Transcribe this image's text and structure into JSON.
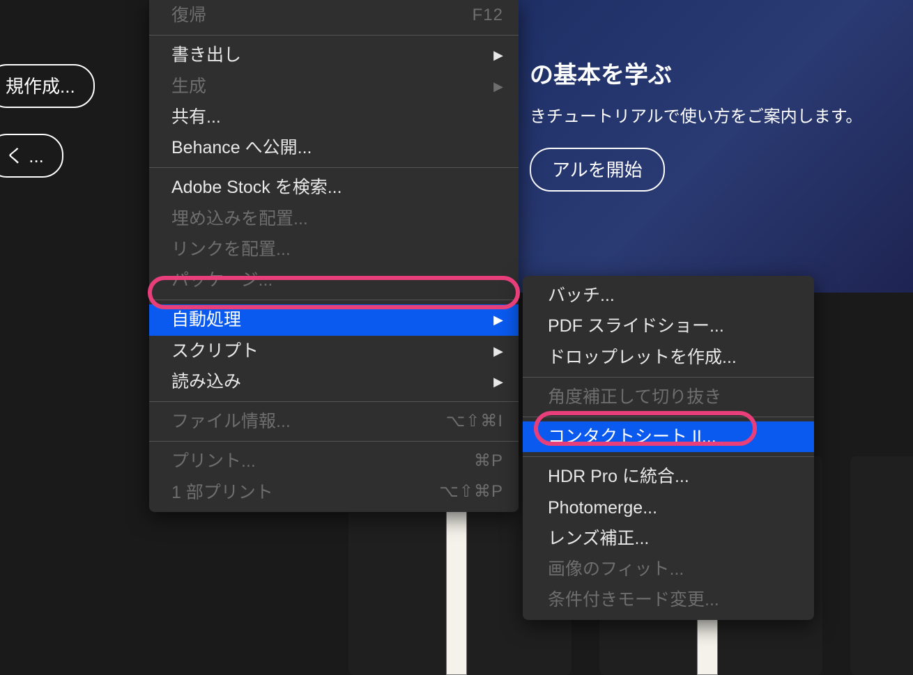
{
  "welcome": {
    "title": "の基本を学ぶ",
    "subtitle": "きチュートリアルで使い方をご案内します。",
    "button": "アルを開始"
  },
  "leftButtons": {
    "new": "規作成...",
    "open": "く ..."
  },
  "menu": {
    "items": [
      {
        "label": "復帰",
        "shortcut": "F12",
        "disabled": true
      },
      {
        "sep": true
      },
      {
        "label": "書き出し",
        "submenu": true
      },
      {
        "label": "生成",
        "submenu": true,
        "disabled": true
      },
      {
        "label": "共有..."
      },
      {
        "label": "Behance へ公開..."
      },
      {
        "sep": true
      },
      {
        "label": "Adobe Stock を検索..."
      },
      {
        "label": "埋め込みを配置...",
        "disabled": true
      },
      {
        "label": "リンクを配置...",
        "disabled": true
      },
      {
        "label": "パッケージ...",
        "disabled": true
      },
      {
        "sep": true
      },
      {
        "label": "自動処理",
        "submenu": true,
        "highlight": true
      },
      {
        "label": "スクリプト",
        "submenu": true
      },
      {
        "label": "読み込み",
        "submenu": true
      },
      {
        "sep": true
      },
      {
        "label": "ファイル情報...",
        "shortcut": "⌥⇧⌘I",
        "disabled": true
      },
      {
        "sep": true
      },
      {
        "label": "プリント...",
        "shortcut": "⌘P",
        "disabled": true
      },
      {
        "label": "1 部プリント",
        "shortcut": "⌥⇧⌘P",
        "disabled": true
      }
    ]
  },
  "submenu": {
    "items": [
      {
        "label": "バッチ..."
      },
      {
        "label": "PDF スライドショー..."
      },
      {
        "label": "ドロップレットを作成..."
      },
      {
        "sep": true
      },
      {
        "label": "角度補正して切り抜き",
        "disabled": true
      },
      {
        "sep": true
      },
      {
        "label": "コンタクトシート II...",
        "highlight": true
      },
      {
        "sep": true
      },
      {
        "label": "HDR Pro に統合..."
      },
      {
        "label": "Photomerge..."
      },
      {
        "label": "レンズ補正..."
      },
      {
        "label": "画像のフィット...",
        "disabled": true
      },
      {
        "label": "条件付きモード変更...",
        "disabled": true
      }
    ]
  }
}
